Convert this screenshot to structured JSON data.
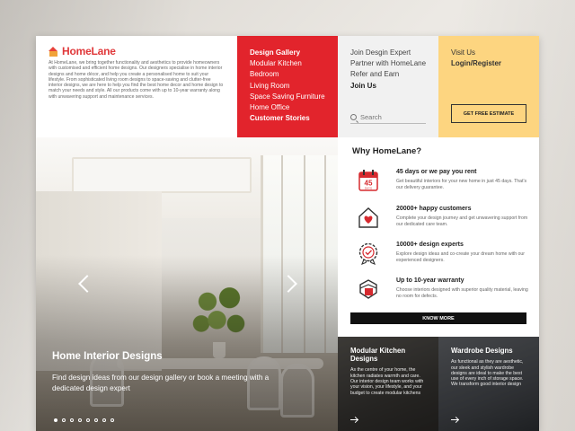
{
  "brand": {
    "name": "HomeLane",
    "description": "At HomeLane, we bring together functionality and aesthetics to provide homeowners with customised and efficient home designs. Our designers specialise in home interior designs and home décor, and help you create a personalised home to suit your lifestyle. From sophisticated living room designs to space-saving and clutter-free interior designs, we are here to help you find the best home decor and home design to match your needs and style. All our products come with up to 10-year warranty along with unwavering support and maintenance services."
  },
  "nav_red": {
    "items": [
      "Design Gallery",
      "Modular Kitchen",
      "Bedroom",
      "Living Room",
      "Space Saving Furniture",
      "Home Office",
      "Customer Stories"
    ]
  },
  "nav_grey": {
    "items": [
      "Join Desgin Expert",
      "Partner with HomeLane",
      "Refer and Earn",
      "Join Us"
    ],
    "search_placeholder": "Search"
  },
  "nav_yellow": {
    "items": [
      "Visit Us",
      "Login/Register"
    ],
    "estimate_label": "GET FREE ESTIMATE"
  },
  "hero": {
    "title": "Home Interior Designs",
    "subtitle": "Find design ideas from our design gallery or book a meeting with a dedicated design expert",
    "slide_count": 8,
    "active_slide": 1
  },
  "why": {
    "title": "Why HomeLane?",
    "calendar_number": "45",
    "calendar_caption": "DAYS",
    "features": [
      {
        "icon": "calendar-45-icon",
        "heading": "45 days or we pay you rent",
        "text": "Get beautiful interiors for your new home in just 45 days. That's our delivery guarantee."
      },
      {
        "icon": "heart-home-icon",
        "heading": "20000+ happy customers",
        "text": "Complete your design journey and get unwavering support from our dedicated care team."
      },
      {
        "icon": "expert-badge-icon",
        "heading": "10000+ design experts",
        "text": "Explore design ideas and co-create your dream home with our experienced designers."
      },
      {
        "icon": "warranty-shield-icon",
        "heading": "Up to 10-year warranty",
        "text": "Choose interiors designed with superior quality material, leaving no room for defects."
      }
    ],
    "know_more_label": "KNOW MORE"
  },
  "cards": {
    "kitchen": {
      "title": "Modular Kitchen Designs",
      "text": "As the centre of your home, the kitchen radiates warmth and care. Our interior design team works with your vision, your lifestyle, and your budget to create modular kitchens"
    },
    "wardrobe": {
      "title": "Wardrobe Designs",
      "text": "As functional as they are aesthetic, our sleek and stylish wardrobe designs are ideal to make the best use of every inch of storage space. We transform good interior design"
    }
  },
  "colors": {
    "brand_red": "#e2242c",
    "accent_yellow": "#fdd580",
    "nav_grey": "#f1f1f1",
    "logo_orange": "#f1a33a"
  }
}
